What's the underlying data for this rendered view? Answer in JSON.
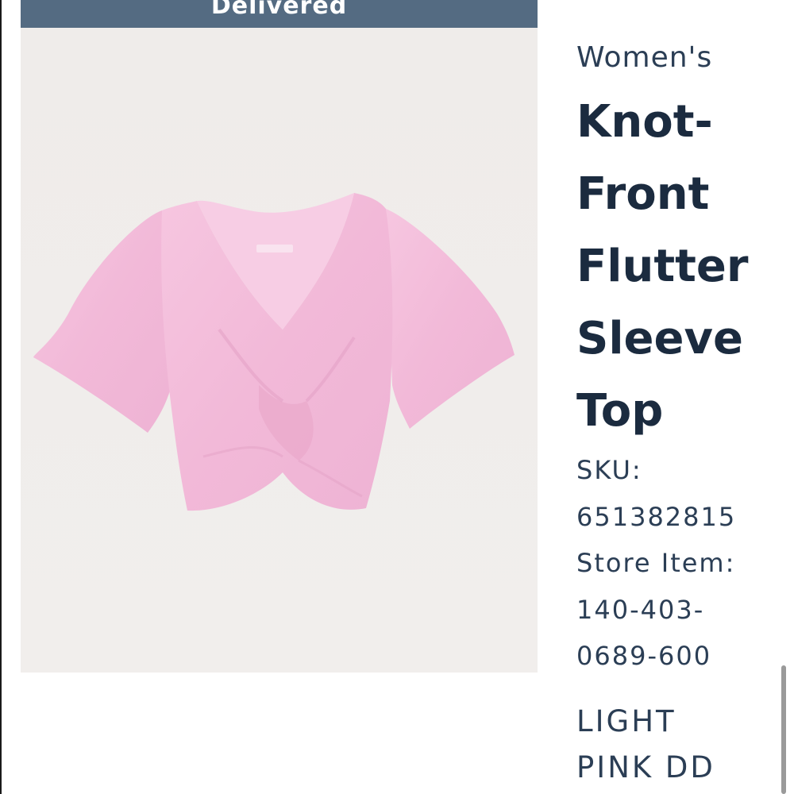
{
  "banner": {
    "status_label": "Delivered",
    "color": "#546b82"
  },
  "product": {
    "image_alt": "pink-knot-front-top",
    "gender": "Women's",
    "title_lines": [
      "Knot-",
      "Front",
      "Flutter",
      "Sleeve",
      "Top"
    ],
    "sku_label": "SKU:",
    "sku_value": "651382815",
    "store_item_label": "Store Item:",
    "store_item_lines": [
      "140-403-",
      "0689-600"
    ],
    "color_lines": [
      "LIGHT",
      "PINK DD"
    ]
  },
  "colors": {
    "text_primary": "#1b2b3f",
    "text_secondary": "#2b3e55",
    "garment": "#f3bddb"
  }
}
